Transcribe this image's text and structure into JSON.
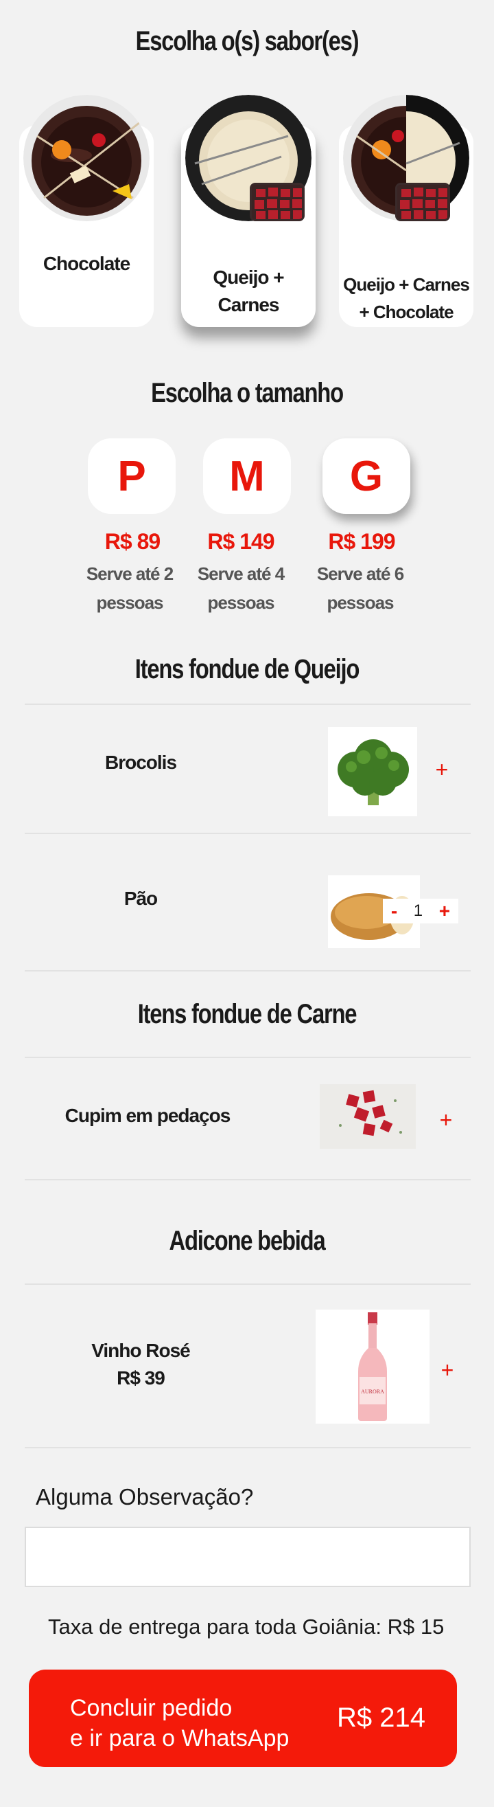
{
  "flavors": {
    "title": "Escolha o(s) sabor(es)",
    "options": [
      {
        "label": "Chocolate"
      },
      {
        "label": "Queijo +\nCarnes"
      },
      {
        "label": "Queijo + Carnes\n+ Chocolate"
      }
    ],
    "selected_index": 1
  },
  "sizes": {
    "title": "Escolha o tamanho",
    "options": [
      {
        "label": "P",
        "price": "R$ 89",
        "serve_line1": "Serve até 2",
        "serve_line2": "pessoas"
      },
      {
        "label": "M",
        "price": "R$ 149",
        "serve_line1": "Serve até 4",
        "serve_line2": "pessoas"
      },
      {
        "label": "G",
        "price": "R$ 199",
        "serve_line1": "Serve até 6",
        "serve_line2": "pessoas"
      }
    ],
    "selected_index": 2
  },
  "cheese_items": {
    "title": "Itens fondue de Queijo",
    "items": [
      {
        "name": "Brocolis",
        "add": "+"
      },
      {
        "name": "Pão",
        "minus": "-",
        "quantity": "1",
        "plus": "+"
      }
    ]
  },
  "meat_items": {
    "title": "Itens fondue de Carne",
    "items": [
      {
        "name": "Cupim em pedaços",
        "add": "+"
      }
    ]
  },
  "drinks": {
    "title": "Adicone bebida",
    "items": [
      {
        "name": "Vinho Rosé",
        "price": "R$ 39",
        "add": "+",
        "bottle_label": "AURORA"
      }
    ]
  },
  "observation": {
    "label": "Alguma Observação?",
    "value": "",
    "placeholder": ""
  },
  "delivery_fee": "Taxa de entrega para toda Goiânia: R$ 15",
  "checkout": {
    "label_line1": "Concluir pedido",
    "label_line2": "e ir para o WhatsApp",
    "total": "R$ 214"
  },
  "colors": {
    "accent": "#e8170b",
    "background": "#f2f2f2",
    "button": "#f41a0a"
  }
}
